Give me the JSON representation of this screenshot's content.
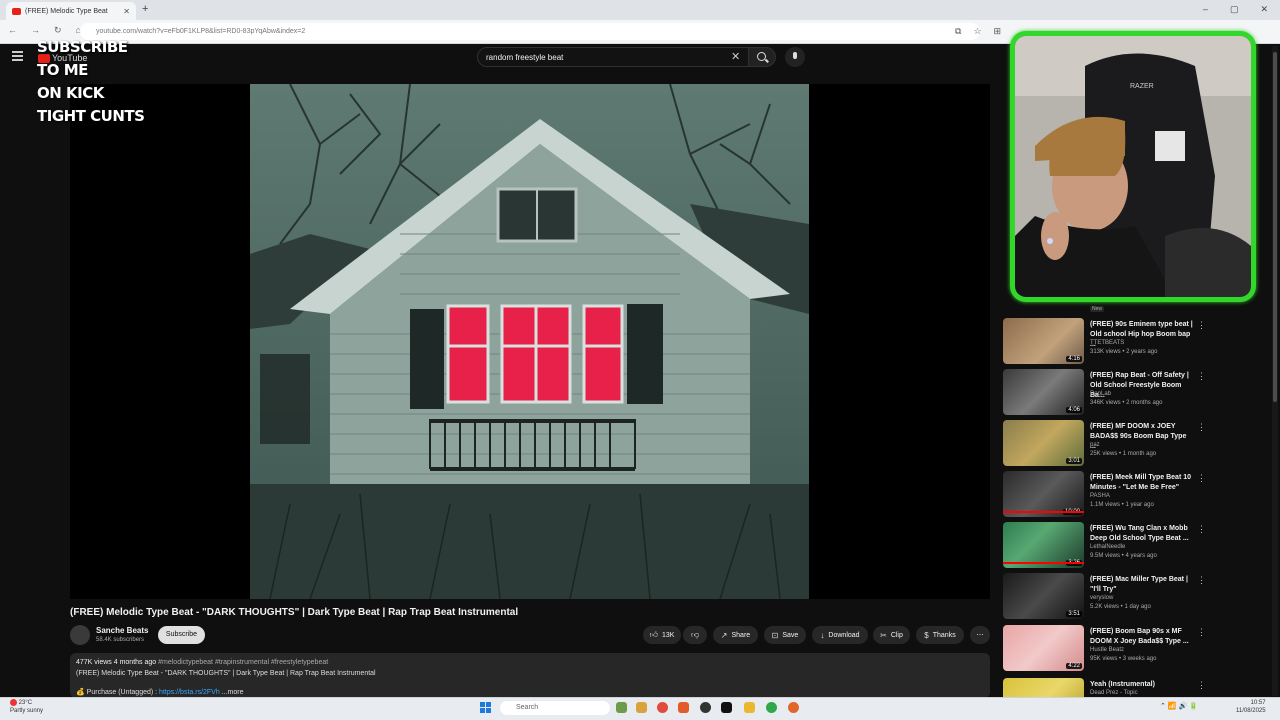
{
  "browser": {
    "tab_title": "(FREE) Melodic Type Beat",
    "url": "youtube.com/watch?v=eFb0F1KLP8&list=RD0-83pYqAbw&index=2",
    "new_tab": "+",
    "window_controls": [
      "–",
      "▢",
      "✕"
    ]
  },
  "youtube": {
    "logo_text": "YouTube",
    "search_value": "random freestyle beat"
  },
  "overlay_lines": [
    "SUBSCRIBE",
    "TO ME",
    "ON KICK",
    "TIGHT CUNTS"
  ],
  "video": {
    "title": "(FREE) Melodic Type Beat - \"DARK THOUGHTS\" | Dark Type Beat | Rap Trap Beat Instrumental",
    "channel": "Sanche Beats",
    "subscribers": "58.4K subscribers",
    "subscribe_label": "Subscribe",
    "likes": "13K",
    "share": "Share",
    "save": "Save",
    "download": "Download",
    "clip": "Clip",
    "thanks": "Thanks",
    "more": "⋯",
    "views_line": "477K views  4 months ago",
    "tags": "#melodictypebeat #trapinstrumental #freestyletypebeat",
    "desc_title": "(FREE) Melodic Type Beat - \"DARK THOUGHTS\" | Dark Type Beat | Rap Trap Beat Instrumental",
    "purchase_label": "Purchase (Untagged) : ",
    "purchase_link": "https://bsta.rs/2FVh",
    "more_label": "...more"
  },
  "sidebar": {
    "new_badge": "New",
    "items": [
      {
        "title": "(FREE) 90s Eminem type beat | Old school Hip hop Boom bap ...",
        "channel": "TTETBEATS",
        "meta": "313K views • 2 years ago",
        "duration": "4:16"
      },
      {
        "title": "(FREE) Rap Beat - Off Safety | Old School Freestyle Boom Ba...",
        "channel": "RapLab",
        "meta": "346K views • 2 months ago",
        "duration": "4:06"
      },
      {
        "title": "(FREE) MF DOOM x JOEY BADA$$ 90s Boom Bap Type ...",
        "channel": "paz",
        "meta": "25K views • 1 month ago",
        "duration": "3:01"
      },
      {
        "title": "(FREE) Meek Mill Type Beat 10 Minutes - \"Let Me Be Free\"",
        "channel": "PASHA",
        "meta": "1.1M views • 1 year ago",
        "duration": "10:00"
      },
      {
        "title": "(FREE) Wu Tang Clan x Mobb Deep Old School Type Beat ...",
        "channel": "LethalNeedle",
        "meta": "9.5M views • 4 years ago",
        "duration": "3:26"
      },
      {
        "title": "(FREE) Mac Miller Type Beat | \"I'll Try\"",
        "channel": "veryslow",
        "meta": "5.2K views • 1 day ago",
        "duration": "3:51"
      },
      {
        "title": "(FREE) Boom Bap 90s x MF DOOM X Joey Bada$$ Type ...",
        "channel": "Hustle Beatz",
        "meta": "95K views • 3 weeks ago",
        "duration": "4:22"
      },
      {
        "title": "Yeah (Instrumental)",
        "channel": "Dead Prez - Topic",
        "meta": "",
        "duration": ""
      }
    ]
  },
  "taskbar": {
    "temp": "23°C",
    "weather": "Partly sunny",
    "search_placeholder": "Search",
    "time": "10:57",
    "date": "11/08/2025"
  },
  "colors": {
    "webcam_border": "#33d62a",
    "progress_red": "#ff0000",
    "accent_link": "#3ea6ff"
  }
}
